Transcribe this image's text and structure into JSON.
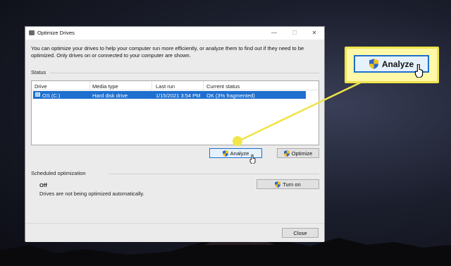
{
  "window": {
    "title": "Optimize Drives",
    "controls": {
      "minimize": "—",
      "maximize": "☐",
      "close": "✕"
    }
  },
  "description": "You can optimize your drives to help your computer run more efficiently, or analyze them to find out if they need to be optimized. Only drives on or connected to your computer are shown.",
  "status": {
    "section_label": "Status",
    "columns": [
      "Drive",
      "Media type",
      "Last run",
      "Current status"
    ],
    "rows": [
      {
        "drive": "OS (C:)",
        "media_type": "Hard disk drive",
        "last_run": "1/15/2021 3:54 PM",
        "current_status": "OK (3% fragmented)",
        "selected": true
      }
    ]
  },
  "buttons": {
    "analyze": "Analyze",
    "optimize": "Optimize",
    "turn_on": "Turn on",
    "close": "Close"
  },
  "scheduled": {
    "section_label": "Scheduled optimization",
    "state": "Off",
    "message": "Drives are not being optimized automatically."
  },
  "callout": {
    "button_label": "Analyze"
  },
  "colors": {
    "selection": "#1e6fcf",
    "callout_yellow": "#efe44a"
  }
}
